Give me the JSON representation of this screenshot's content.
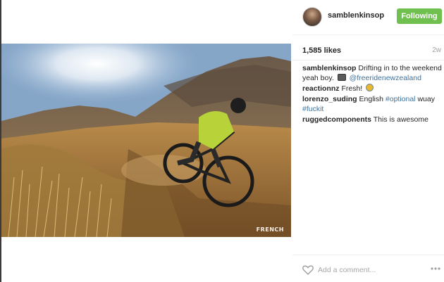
{
  "post": {
    "username": "samblenkinsop",
    "follow_label": "Following",
    "likes": "1,585 likes",
    "age": "2w",
    "watermark": "FRENCH",
    "comments": [
      {
        "user": "samblenkinsop",
        "text": "Drifting in to the weekend yeah boy.",
        "emoji": "camera",
        "tag": "@freeridenewzealand"
      },
      {
        "user": "reactionnz",
        "text": "Fresh!",
        "emoji": "face"
      },
      {
        "user": "lorenzo_suding",
        "text": "English",
        "tag1": "#optional",
        "text2": "wuay",
        "tag2": "#fuckit"
      },
      {
        "user": "ruggedcomponents",
        "text": "This is awesome"
      }
    ],
    "add_comment_placeholder": "Add a comment..."
  },
  "colors": {
    "follow_button": "#70c050",
    "link": "#3f729b",
    "muted": "#a0a0a0"
  },
  "icons": {
    "like": "heart-outline-icon",
    "more": "ellipsis-icon",
    "avatar": "avatar"
  }
}
